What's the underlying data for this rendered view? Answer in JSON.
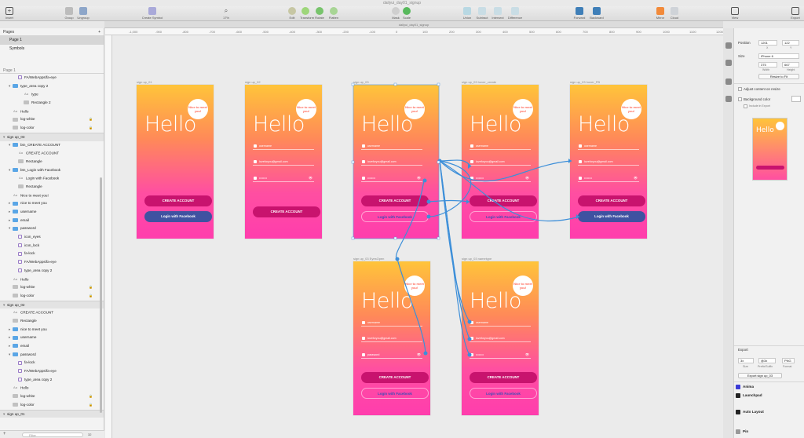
{
  "window": {
    "title": "dailyui_day01_signup"
  },
  "toolbar": {
    "left": [
      {
        "label": "Insert",
        "icon": "plus-icon"
      }
    ],
    "group1": [
      {
        "label": "Group",
        "icon": "group-icon"
      },
      {
        "label": "Ungroup",
        "icon": "ungroup-icon"
      }
    ],
    "create_symbol": "Create Symbol",
    "zoom": {
      "value": "17%",
      "minus": "−",
      "plus": "+"
    },
    "group2": [
      {
        "label": "Edit",
        "icon": "edit-icon"
      },
      {
        "label": "Transform",
        "icon": "transform-icon"
      },
      {
        "label": "Rotate",
        "icon": "rotate-icon"
      },
      {
        "label": "Flatten",
        "icon": "flatten-icon"
      },
      {
        "label": "Mask",
        "icon": "mask-icon"
      },
      {
        "label": "Scale",
        "icon": "scale-icon"
      }
    ],
    "group3": [
      {
        "label": "Union",
        "icon": "union-icon"
      },
      {
        "label": "Subtract",
        "icon": "subtract-icon"
      },
      {
        "label": "Intersect",
        "icon": "intersect-icon"
      },
      {
        "label": "Difference",
        "icon": "difference-icon"
      }
    ],
    "group4": [
      {
        "label": "Forward",
        "icon": "forward-icon"
      },
      {
        "label": "Backward",
        "icon": "backward-icon"
      }
    ],
    "group5": [
      {
        "label": "Mirror",
        "icon": "mirror-icon"
      },
      {
        "label": "Cloud",
        "icon": "cloud-icon"
      }
    ],
    "group6": [
      {
        "label": "View",
        "icon": "view-icon"
      },
      {
        "label": "Export",
        "icon": "export-icon"
      }
    ]
  },
  "doc_tab": "dailyui_day01_signup",
  "ruler_ticks": [
    "-1,000",
    "-900",
    "-800",
    "-700",
    "-600",
    "-500",
    "-400",
    "-300",
    "-200",
    "-100",
    "0",
    "100",
    "200",
    "300",
    "400",
    "500",
    "600",
    "700",
    "800",
    "900",
    "1000",
    "1100",
    "1200"
  ],
  "left_panel": {
    "pages_title": "Pages",
    "pages_add": "+",
    "pages": [
      {
        "name": "Page 1",
        "selected": true
      },
      {
        "name": "Symbols",
        "selected": false
      }
    ],
    "layers_title": "Page 1",
    "layers": [
      {
        "name": "FA/WebApps/fa-eye",
        "type": "path",
        "indent": 2
      },
      {
        "name": "type_area copy 2",
        "type": "folder",
        "indent": 1,
        "chev": "▾"
      },
      {
        "name": "type",
        "type": "text",
        "indent": 3
      },
      {
        "name": "Rectangle 2",
        "type": "shape",
        "indent": 3
      },
      {
        "name": "Hello",
        "type": "text",
        "indent": 1
      },
      {
        "name": "log-white",
        "type": "shape",
        "indent": 1,
        "lock": true
      },
      {
        "name": "log-color",
        "type": "shape",
        "indent": 1,
        "lock": true
      },
      {
        "name": "sign up_03",
        "type": "artboard",
        "indent": 0,
        "group": true,
        "chev": "▾"
      },
      {
        "name": "btn_CREATE ACCOUNT",
        "type": "folder",
        "indent": 1,
        "chev": "▾"
      },
      {
        "name": "CREATE ACCOUNT",
        "type": "text",
        "indent": 2
      },
      {
        "name": "Rectangle",
        "type": "shape",
        "indent": 2
      },
      {
        "name": "btn_Login with Facebook",
        "type": "folder",
        "indent": 1,
        "chev": "▾"
      },
      {
        "name": "Login with Facebook",
        "type": "text",
        "indent": 2
      },
      {
        "name": "Rectangle",
        "type": "shape",
        "indent": 2
      },
      {
        "name": "Nice to meet you!",
        "type": "text",
        "indent": 1
      },
      {
        "name": "nice to meet you",
        "type": "folder",
        "indent": 1,
        "chev": "▸"
      },
      {
        "name": "username",
        "type": "folder",
        "indent": 1,
        "chev": "▸"
      },
      {
        "name": "email",
        "type": "folder",
        "indent": 1,
        "chev": "▸"
      },
      {
        "name": "password",
        "type": "folder",
        "indent": 1,
        "chev": "▾"
      },
      {
        "name": "icon_eyes",
        "type": "path",
        "indent": 2
      },
      {
        "name": "icon_lock",
        "type": "path",
        "indent": 2
      },
      {
        "name": "fa-lock",
        "type": "path",
        "indent": 2
      },
      {
        "name": "FA/WebApps/fa-eye",
        "type": "path",
        "indent": 2
      },
      {
        "name": "type_area copy 2",
        "type": "path",
        "indent": 2
      },
      {
        "name": "Hello",
        "type": "text",
        "indent": 1
      },
      {
        "name": "log-white",
        "type": "shape",
        "indent": 1,
        "lock": true
      },
      {
        "name": "log-color",
        "type": "shape",
        "indent": 1,
        "lock": true
      },
      {
        "name": "sign up_02",
        "type": "artboard",
        "indent": 0,
        "group": true,
        "chev": "▾"
      },
      {
        "name": "CREATE ACCOUNT",
        "type": "text",
        "indent": 1
      },
      {
        "name": "Rectangle",
        "type": "shape",
        "indent": 1
      },
      {
        "name": "nice to meet you",
        "type": "folder",
        "indent": 1,
        "chev": "▸"
      },
      {
        "name": "username",
        "type": "folder",
        "indent": 1,
        "chev": "▸"
      },
      {
        "name": "email",
        "type": "folder",
        "indent": 1,
        "chev": "▸"
      },
      {
        "name": "password",
        "type": "folder",
        "indent": 1,
        "chev": "▾"
      },
      {
        "name": "fa-lock",
        "type": "path",
        "indent": 2
      },
      {
        "name": "FA/WebApps/fa-eye",
        "type": "path",
        "indent": 2
      },
      {
        "name": "type_area copy 2",
        "type": "path",
        "indent": 2
      },
      {
        "name": "Hello",
        "type": "text",
        "indent": 1
      },
      {
        "name": "log-white",
        "type": "shape",
        "indent": 1,
        "lock": true
      },
      {
        "name": "log-color",
        "type": "shape",
        "indent": 1,
        "lock": true
      },
      {
        "name": "sign up_01",
        "type": "artboard",
        "indent": 0,
        "group": true,
        "chev": "▾"
      }
    ],
    "filter_placeholder": "Filter",
    "filter_count": "32"
  },
  "artboards": [
    {
      "label": "sign up_01",
      "hello": "Hello",
      "bubble": "Nice to meet you!",
      "fields": false,
      "create": "CREATE ACCOUNT",
      "fb": "Login with Facebook",
      "fb_style": "solid"
    },
    {
      "label": "sign up_02",
      "hello": "Hello",
      "bubble": "Nice to meet you!",
      "fields": true,
      "username": "username",
      "email": "loveforyou@gmail.com",
      "password": "••••••••",
      "create": "CREATE ACCOUNT",
      "fb": "",
      "fb_style": "none"
    },
    {
      "label": "sign up_03",
      "hello": "Hello",
      "bubble": "Nice to meet you!",
      "fields": true,
      "username": "username",
      "email": "loveforyou@gmail.com",
      "password": "••••••••",
      "create": "CREATE ACCOUNT",
      "fb": "Login with Facebook",
      "fb_style": "ghost"
    },
    {
      "label": "sign up_03 hover_create",
      "hello": "Hello",
      "bubble": "Nice to meet you!",
      "fields": true,
      "username": "username",
      "email": "loveforyou@gmail.com",
      "password": "••••••••",
      "create": "CREATE ACCOUNT",
      "fb": "Login with Facebook",
      "fb_style": "ghost"
    },
    {
      "label": "sign up_03 hover_FB",
      "hello": "Hello",
      "bubble": "Nice to meet you!",
      "fields": true,
      "username": "username",
      "email": "loveforyou@gmail.com",
      "password": "••••••••",
      "create": "CREATE ACCOUNT",
      "fb": "Login with Facebook",
      "fb_style": "solid"
    },
    {
      "label": "sign up_03 EyesOpen",
      "hello": "Hello",
      "bubble": "Nice to meet you!",
      "fields": true,
      "username": "username",
      "email": "loveforyou@gmail.com",
      "password": "password",
      "create": "CREATE ACCOUNT",
      "fb": "Login with Facebook",
      "fb_style": "ghost"
    },
    {
      "label": "sign up_03 nametype",
      "hello": "Hello",
      "bubble": "Nice to meet you!",
      "fields": true,
      "username": "username",
      "email": "loveforyou@gmail.com",
      "password": "••••••••",
      "create": "CREATE ACCOUNT",
      "fb": "Login with Facebook",
      "fb_style": "ghost"
    }
  ],
  "inspector": {
    "position_label": "Position",
    "x": "1201",
    "y": "122",
    "x_label": "X",
    "y_label": "Y",
    "size_label": "Size",
    "size_preset": "iPhone 6",
    "width": "375",
    "height": "667",
    "width_label": "Width",
    "height_label": "Height",
    "resize_btn": "Resize to Fit",
    "adjust_label": "Adjust content on resize",
    "bg_label": "Background color",
    "include_label": "Include in Export",
    "export_label": "Export",
    "export_scale": "3x",
    "export_suffix": "@3x",
    "export_format": "PNG",
    "scale_label": "Size",
    "suffix_label": "Prefix/Suffix",
    "format_label": "Format",
    "export_btn": "Export sign up_03",
    "plugins": [
      "Anima",
      "Launchpad",
      "Auto Layout",
      "Pin"
    ]
  }
}
